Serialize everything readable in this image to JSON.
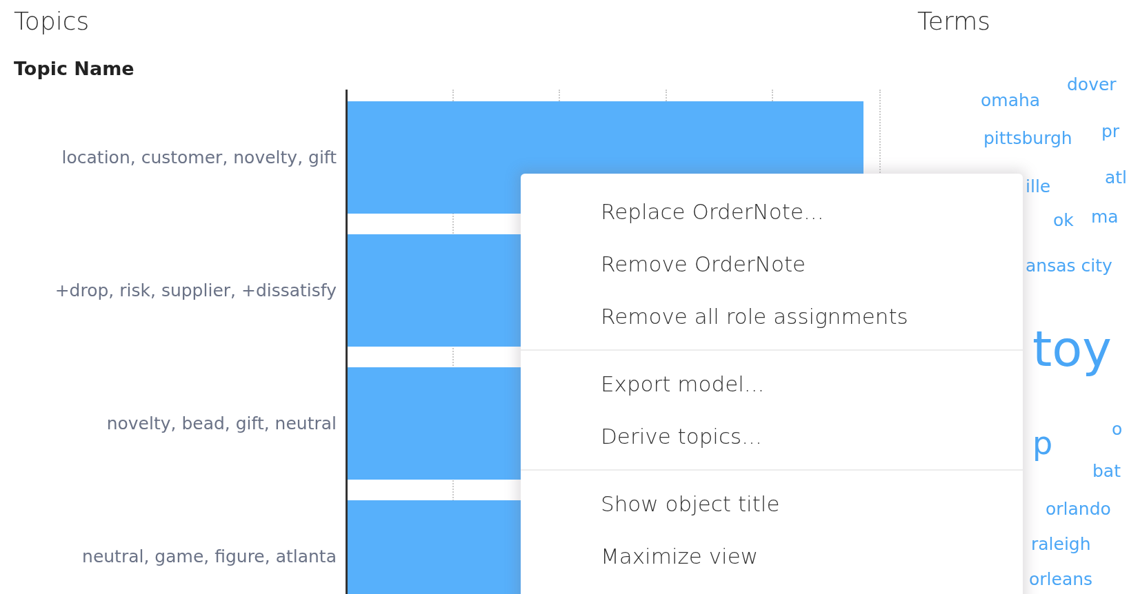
{
  "topics_panel": {
    "title": "Topics",
    "column_header": "Topic Name",
    "topics": [
      {
        "label": "location, customer, novelty, gift"
      },
      {
        "label": "+drop, risk, supplier, +dissatisfy"
      },
      {
        "label": "novelty, bead, gift, neutral"
      },
      {
        "label": "neutral, game, figure, atlanta"
      }
    ]
  },
  "terms_panel": {
    "title": "Terms",
    "words": [
      {
        "text": "dover",
        "kind": "small"
      },
      {
        "text": "omaha",
        "kind": "small"
      },
      {
        "text": "pittsburgh",
        "kind": "small"
      },
      {
        "text": "pr",
        "kind": "small"
      },
      {
        "text": "ille",
        "kind": "small"
      },
      {
        "text": "atl",
        "kind": "small"
      },
      {
        "text": "ok",
        "kind": "small"
      },
      {
        "text": "ma",
        "kind": "small"
      },
      {
        "text": "ansas city",
        "kind": "small"
      },
      {
        "text": "toy",
        "kind": "large"
      },
      {
        "text": "p",
        "kind": "medium"
      },
      {
        "text": "o",
        "kind": "small"
      },
      {
        "text": "bat",
        "kind": "small"
      },
      {
        "text": "orlando",
        "kind": "small"
      },
      {
        "text": "raleigh",
        "kind": "small"
      },
      {
        "text": "orleans",
        "kind": "small"
      }
    ]
  },
  "context_menu": {
    "sections": [
      [
        "Replace OrderNote...",
        "Remove OrderNote",
        "Remove all role assignments"
      ],
      [
        "Export model...",
        "Derive topics..."
      ],
      [
        "Show object title",
        "Maximize view"
      ]
    ]
  }
}
